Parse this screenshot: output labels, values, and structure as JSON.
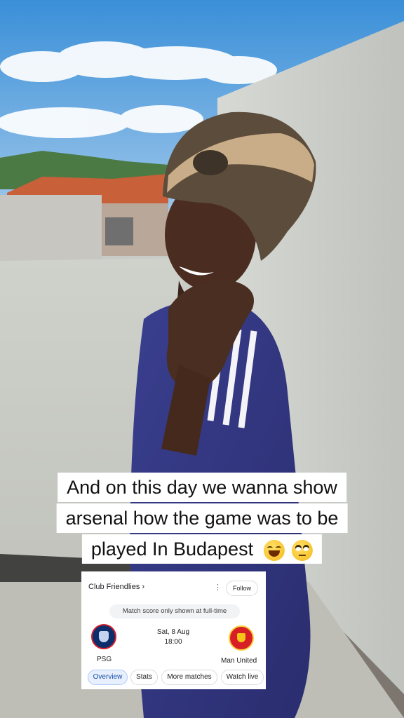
{
  "caption": {
    "line1": "And on this day we wanna show",
    "line2": "arsenal how the game was to be",
    "line3": "played In Budapest"
  },
  "match_card": {
    "competition": "Club Friendlies ›",
    "menu_icon": "⋮",
    "follow_label": "Follow",
    "notice": "Match score only shown at full-time",
    "home_team": "PSG",
    "away_team": "Man United",
    "date": "Sat, 8 Aug",
    "time": "18:00",
    "tabs": [
      "Overview",
      "Stats",
      "More matches",
      "Watch live"
    ],
    "active_tab": "Overview"
  },
  "icons": {
    "emoji_1": "face-with-tears-of-joy-icon",
    "emoji_2": "face-with-rolling-eyes-icon",
    "home_crest": "psg-crest-icon",
    "away_crest": "man-united-crest-icon"
  }
}
